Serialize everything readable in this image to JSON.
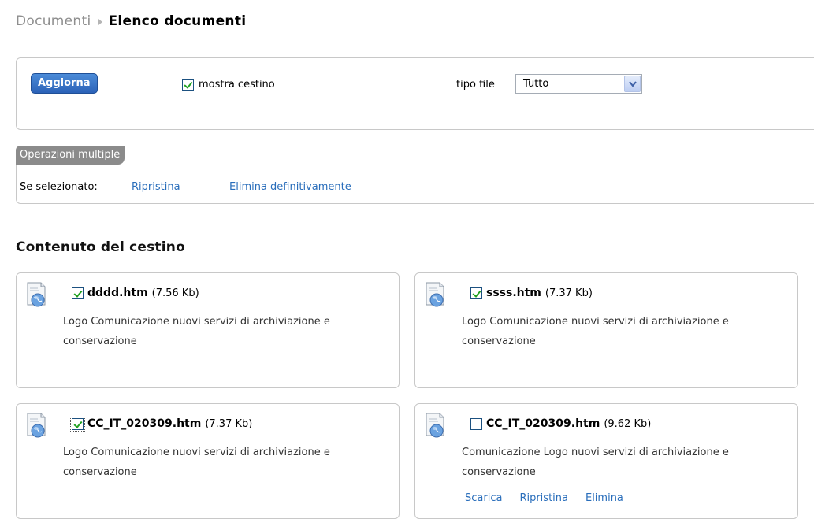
{
  "breadcrumb": {
    "root": "Documenti",
    "current": "Elenco documenti"
  },
  "filter": {
    "refresh_label": "Aggiorna",
    "show_trash_label": "mostra cestino",
    "show_trash_checked": true,
    "file_type_label": "tipo file",
    "file_type_value": "Tutto"
  },
  "multi": {
    "title": "Operazioni multiple",
    "selected_label": "Se selezionato:",
    "restore_label": "Ripristina",
    "delete_label": "Elimina definitivamente"
  },
  "trash": {
    "title": "Contenuto del cestino",
    "items": [
      {
        "name": "dddd.htm",
        "size": "(7.56 Kb)",
        "checked": true,
        "desc": "Logo Comunicazione nuovi servizi di archiviazione e conservazione"
      },
      {
        "name": "ssss.htm",
        "size": "(7.37 Kb)",
        "checked": true,
        "desc": "Logo Comunicazione nuovi servizi di archiviazione e conservazione"
      },
      {
        "name": "CC_IT_020309.htm",
        "size": "(7.37 Kb)",
        "checked": true,
        "desc": "Logo Comunicazione nuovi servizi di archiviazione e conservazione"
      },
      {
        "name": "CC_IT_020309.htm",
        "size": "(9.62 Kb)",
        "checked": false,
        "desc": "Comunicazione Logo nuovi servizi di archiviazione e conservazione",
        "actions": {
          "download": "Scarica",
          "restore": "Ripristina",
          "delete": "Elimina"
        }
      }
    ]
  },
  "colors": {
    "link": "#2a6ebb",
    "button": "#2b62b8",
    "check": "#21a121",
    "section_header": "#8b8b8b"
  },
  "icons": {
    "file": "web-document-icon",
    "dropdown": "chevron-down-icon",
    "breadcrumb_separator": "triangle-right-icon"
  }
}
